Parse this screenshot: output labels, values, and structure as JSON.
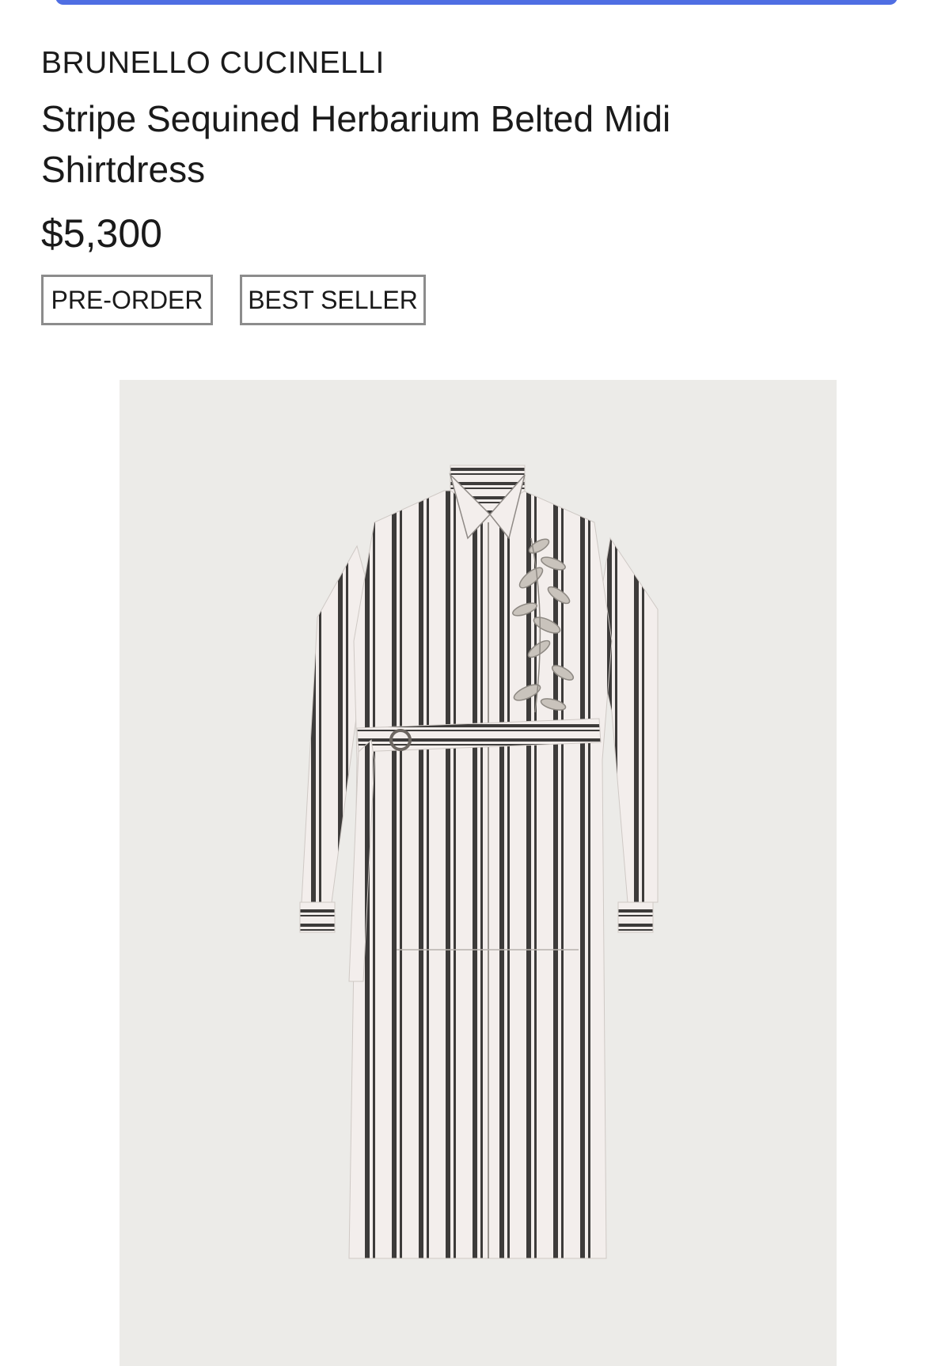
{
  "product": {
    "brand": "BRUNELLO CUCINELLI",
    "title": "Stripe Sequined Herbarium Belted Midi Shirtdress",
    "price": "$5,300",
    "badges": [
      "PRE-ORDER",
      "BEST SELLER"
    ]
  },
  "colors": {
    "accent_bar": "#4f6ee3",
    "image_background": "#ecebe8",
    "stripe_dark": "#3d3b3a",
    "stripe_light": "#f3eeec"
  }
}
